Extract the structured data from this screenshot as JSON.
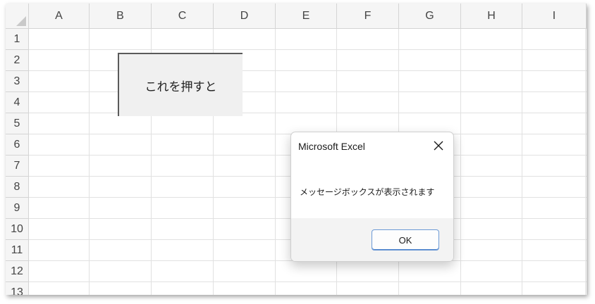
{
  "spreadsheet": {
    "columns": [
      "A",
      "B",
      "C",
      "D",
      "E",
      "F",
      "G",
      "H",
      "I"
    ],
    "rows": [
      "1",
      "2",
      "3",
      "4",
      "5",
      "6",
      "7",
      "8",
      "9",
      "10",
      "11",
      "12",
      "13"
    ]
  },
  "sheet_button": {
    "label": "これを押すと"
  },
  "dialog": {
    "title": "Microsoft Excel",
    "close_icon": "close-icon",
    "message": "メッセージボックスが表示されます",
    "ok_label": "OK"
  },
  "colors": {
    "header_bg": "#f5f5f5",
    "gridline": "#e1e1e1",
    "button_bg": "#f0f0f0",
    "dialog_footer": "#f3f3f3",
    "ok_border": "#6c9ad6"
  }
}
